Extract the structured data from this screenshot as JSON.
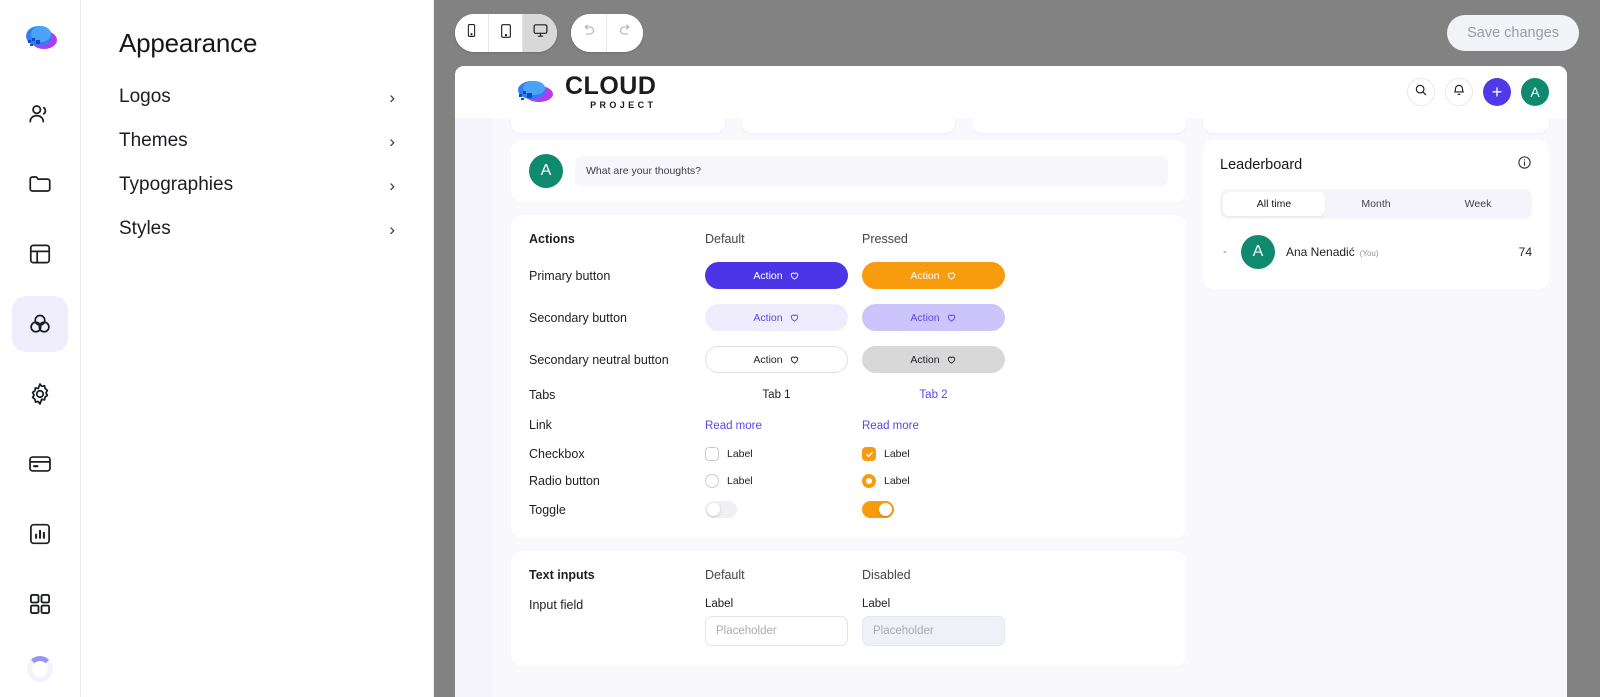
{
  "rail": {
    "logo_icon": "cloud-logo-icon",
    "items": [
      {
        "icon": "people-icon",
        "name": "users",
        "active": false
      },
      {
        "icon": "folder-icon",
        "name": "projects",
        "active": false
      },
      {
        "icon": "layout-icon",
        "name": "layout",
        "active": false
      },
      {
        "icon": "appearance-icon",
        "name": "appearance",
        "active": true
      },
      {
        "icon": "gear-icon",
        "name": "settings",
        "active": false
      },
      {
        "icon": "credit-card-icon",
        "name": "billing",
        "active": false
      },
      {
        "icon": "bar-chart-icon",
        "name": "analytics",
        "active": false
      },
      {
        "icon": "grid-icon",
        "name": "apps",
        "active": false
      }
    ],
    "spinner_icon": "loading-spinner-icon"
  },
  "nav": {
    "title": "Appearance",
    "items": [
      {
        "label": "Logos",
        "chevron": "›"
      },
      {
        "label": "Themes",
        "chevron": "›"
      },
      {
        "label": "Typographies",
        "chevron": "›"
      },
      {
        "label": "Styles",
        "chevron": "›"
      }
    ]
  },
  "toolbar": {
    "devices": [
      {
        "icon": "mobile-icon",
        "name": "mobile",
        "selected": false
      },
      {
        "icon": "tablet-icon",
        "name": "tablet",
        "selected": false
      },
      {
        "icon": "desktop-icon",
        "name": "desktop",
        "selected": true
      }
    ],
    "undo_icon": "undo-icon",
    "redo_icon": "redo-icon",
    "save_label": "Save changes"
  },
  "preview": {
    "brand": {
      "primary": "CLOUD",
      "secondary": "PROJECT"
    },
    "header_actions": {
      "search_icon": "search-icon",
      "bell_icon": "bell-icon",
      "plus_label": "+",
      "avatar_initial": "A"
    },
    "comment": {
      "avatar_initial": "A",
      "placeholder": "What are your thoughts?"
    },
    "actions": {
      "title": "Actions",
      "col_default": "Default",
      "col_pressed": "Pressed",
      "rows": [
        {
          "label": "Primary button",
          "default_text": "Action",
          "pressed_text": "Action"
        },
        {
          "label": "Secondary button",
          "default_text": "Action",
          "pressed_text": "Action"
        },
        {
          "label": "Secondary neutral button",
          "default_text": "Action",
          "pressed_text": "Action"
        }
      ],
      "tabs": {
        "label": "Tabs",
        "tab1": "Tab 1",
        "tab2": "Tab 2"
      },
      "link": {
        "label": "Link",
        "default_text": "Read more",
        "pressed_text": "Read more"
      },
      "checkbox": {
        "label": "Checkbox",
        "default_text": "Label",
        "pressed_text": "Label"
      },
      "radio": {
        "label": "Radio button",
        "default_text": "Label",
        "pressed_text": "Label"
      },
      "toggle": {
        "label": "Toggle"
      }
    },
    "text_inputs": {
      "title": "Text inputs",
      "col_default": "Default",
      "col_disabled": "Disabled",
      "row_label": "Input field",
      "field_label_default": "Label",
      "field_label_disabled": "Label",
      "placeholder_default": "Placeholder",
      "placeholder_disabled": "Placeholder"
    },
    "leaderboard": {
      "title": "Leaderboard",
      "info_icon": "info-icon",
      "tabs": [
        {
          "label": "All time",
          "active": true
        },
        {
          "label": "Month",
          "active": false
        },
        {
          "label": "Week",
          "active": false
        }
      ],
      "rows": [
        {
          "rank": "-",
          "avatar_initial": "A",
          "name": "Ana Nenadić",
          "you": "(You)",
          "score": "74"
        }
      ]
    }
  },
  "colors": {
    "primary": "#4c35e6",
    "pressed": "#f89c0e",
    "secondary_bg": "#eeecfd",
    "secondary_pressed_bg": "#ccc5fb",
    "link": "#5b45ea",
    "avatar": "#0f8a6f",
    "stage": "#828282",
    "surface": "#f8f8fd"
  }
}
